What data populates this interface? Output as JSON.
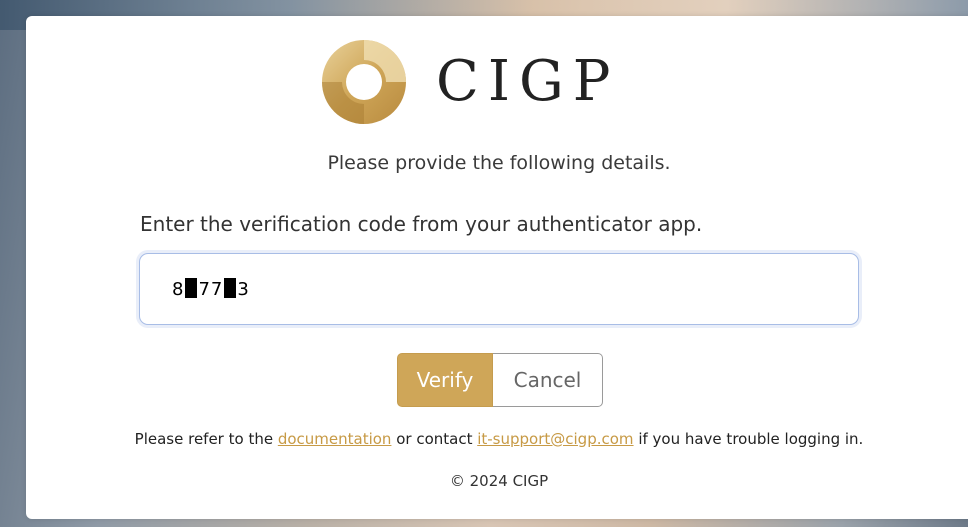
{
  "brand": {
    "logo_text": "CIGP",
    "logo_icon": "ring-logo-icon",
    "color": "#cfa658"
  },
  "form": {
    "subtitle": "Please provide the following details.",
    "code_label": "Enter the verification code from your authenticator app.",
    "code_value": "8█77█3",
    "code_parts": [
      "8",
      "77",
      "3"
    ]
  },
  "buttons": {
    "verify_label": "Verify",
    "cancel_label": "Cancel"
  },
  "help": {
    "prefix": "Please refer to the ",
    "doc_link": "documentation",
    "middle": " or contact ",
    "email_link": "it-support@cigp.com",
    "suffix": " if you have trouble logging in."
  },
  "footer": {
    "copyright": "© 2024 CIGP"
  }
}
